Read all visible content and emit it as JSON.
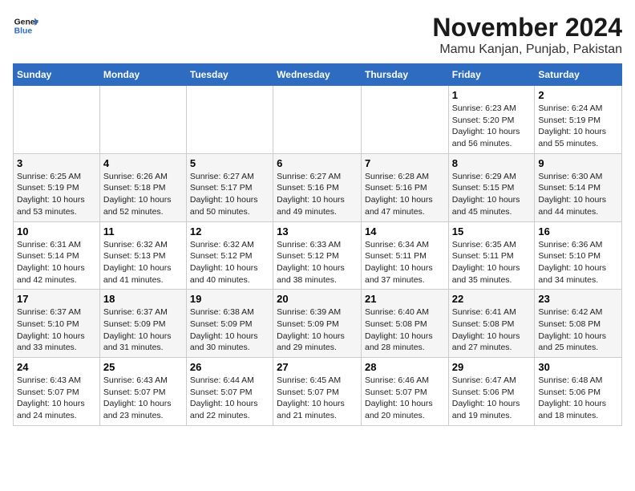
{
  "logo": {
    "line1": "General",
    "line2": "Blue"
  },
  "title": "November 2024",
  "location": "Mamu Kanjan, Punjab, Pakistan",
  "weekdays": [
    "Sunday",
    "Monday",
    "Tuesday",
    "Wednesday",
    "Thursday",
    "Friday",
    "Saturday"
  ],
  "weeks": [
    [
      {
        "day": "",
        "info": ""
      },
      {
        "day": "",
        "info": ""
      },
      {
        "day": "",
        "info": ""
      },
      {
        "day": "",
        "info": ""
      },
      {
        "day": "",
        "info": ""
      },
      {
        "day": "1",
        "info": "Sunrise: 6:23 AM\nSunset: 5:20 PM\nDaylight: 10 hours and 56 minutes."
      },
      {
        "day": "2",
        "info": "Sunrise: 6:24 AM\nSunset: 5:19 PM\nDaylight: 10 hours and 55 minutes."
      }
    ],
    [
      {
        "day": "3",
        "info": "Sunrise: 6:25 AM\nSunset: 5:19 PM\nDaylight: 10 hours and 53 minutes."
      },
      {
        "day": "4",
        "info": "Sunrise: 6:26 AM\nSunset: 5:18 PM\nDaylight: 10 hours and 52 minutes."
      },
      {
        "day": "5",
        "info": "Sunrise: 6:27 AM\nSunset: 5:17 PM\nDaylight: 10 hours and 50 minutes."
      },
      {
        "day": "6",
        "info": "Sunrise: 6:27 AM\nSunset: 5:16 PM\nDaylight: 10 hours and 49 minutes."
      },
      {
        "day": "7",
        "info": "Sunrise: 6:28 AM\nSunset: 5:16 PM\nDaylight: 10 hours and 47 minutes."
      },
      {
        "day": "8",
        "info": "Sunrise: 6:29 AM\nSunset: 5:15 PM\nDaylight: 10 hours and 45 minutes."
      },
      {
        "day": "9",
        "info": "Sunrise: 6:30 AM\nSunset: 5:14 PM\nDaylight: 10 hours and 44 minutes."
      }
    ],
    [
      {
        "day": "10",
        "info": "Sunrise: 6:31 AM\nSunset: 5:14 PM\nDaylight: 10 hours and 42 minutes."
      },
      {
        "day": "11",
        "info": "Sunrise: 6:32 AM\nSunset: 5:13 PM\nDaylight: 10 hours and 41 minutes."
      },
      {
        "day": "12",
        "info": "Sunrise: 6:32 AM\nSunset: 5:12 PM\nDaylight: 10 hours and 40 minutes."
      },
      {
        "day": "13",
        "info": "Sunrise: 6:33 AM\nSunset: 5:12 PM\nDaylight: 10 hours and 38 minutes."
      },
      {
        "day": "14",
        "info": "Sunrise: 6:34 AM\nSunset: 5:11 PM\nDaylight: 10 hours and 37 minutes."
      },
      {
        "day": "15",
        "info": "Sunrise: 6:35 AM\nSunset: 5:11 PM\nDaylight: 10 hours and 35 minutes."
      },
      {
        "day": "16",
        "info": "Sunrise: 6:36 AM\nSunset: 5:10 PM\nDaylight: 10 hours and 34 minutes."
      }
    ],
    [
      {
        "day": "17",
        "info": "Sunrise: 6:37 AM\nSunset: 5:10 PM\nDaylight: 10 hours and 33 minutes."
      },
      {
        "day": "18",
        "info": "Sunrise: 6:37 AM\nSunset: 5:09 PM\nDaylight: 10 hours and 31 minutes."
      },
      {
        "day": "19",
        "info": "Sunrise: 6:38 AM\nSunset: 5:09 PM\nDaylight: 10 hours and 30 minutes."
      },
      {
        "day": "20",
        "info": "Sunrise: 6:39 AM\nSunset: 5:09 PM\nDaylight: 10 hours and 29 minutes."
      },
      {
        "day": "21",
        "info": "Sunrise: 6:40 AM\nSunset: 5:08 PM\nDaylight: 10 hours and 28 minutes."
      },
      {
        "day": "22",
        "info": "Sunrise: 6:41 AM\nSunset: 5:08 PM\nDaylight: 10 hours and 27 minutes."
      },
      {
        "day": "23",
        "info": "Sunrise: 6:42 AM\nSunset: 5:08 PM\nDaylight: 10 hours and 25 minutes."
      }
    ],
    [
      {
        "day": "24",
        "info": "Sunrise: 6:43 AM\nSunset: 5:07 PM\nDaylight: 10 hours and 24 minutes."
      },
      {
        "day": "25",
        "info": "Sunrise: 6:43 AM\nSunset: 5:07 PM\nDaylight: 10 hours and 23 minutes."
      },
      {
        "day": "26",
        "info": "Sunrise: 6:44 AM\nSunset: 5:07 PM\nDaylight: 10 hours and 22 minutes."
      },
      {
        "day": "27",
        "info": "Sunrise: 6:45 AM\nSunset: 5:07 PM\nDaylight: 10 hours and 21 minutes."
      },
      {
        "day": "28",
        "info": "Sunrise: 6:46 AM\nSunset: 5:07 PM\nDaylight: 10 hours and 20 minutes."
      },
      {
        "day": "29",
        "info": "Sunrise: 6:47 AM\nSunset: 5:06 PM\nDaylight: 10 hours and 19 minutes."
      },
      {
        "day": "30",
        "info": "Sunrise: 6:48 AM\nSunset: 5:06 PM\nDaylight: 10 hours and 18 minutes."
      }
    ]
  ]
}
